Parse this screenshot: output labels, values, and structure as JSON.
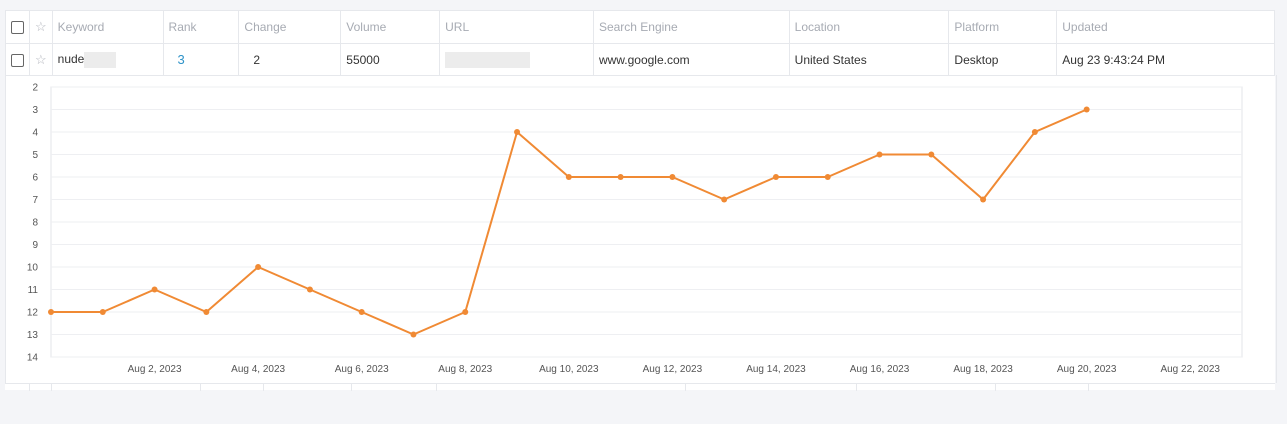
{
  "table": {
    "headers": {
      "keyword": "Keyword",
      "rank": "Rank",
      "change": "Change",
      "volume": "Volume",
      "url": "URL",
      "search_engine": "Search Engine",
      "location": "Location",
      "platform": "Platform",
      "updated": "Updated"
    },
    "row": {
      "keyword": "nude",
      "rank": "3",
      "change": "2",
      "volume": "55000",
      "url": "",
      "search_engine": "www.google.com",
      "location": "United States",
      "platform": "Desktop",
      "updated": "Aug 23 9:43:24 PM"
    }
  },
  "chart_data": {
    "type": "line",
    "title": "",
    "xlabel": "",
    "ylabel": "",
    "y_reversed": true,
    "ylim": [
      2,
      14
    ],
    "y_ticks": [
      "2",
      "3",
      "4",
      "5",
      "6",
      "7",
      "8",
      "9",
      "10",
      "11",
      "12",
      "13",
      "14"
    ],
    "x_range": [
      "2023-07-31",
      "2023-08-23"
    ],
    "x_tick_labels": [
      "Aug 2, 2023",
      "Aug 4, 2023",
      "Aug 6, 2023",
      "Aug 8, 2023",
      "Aug 10, 2023",
      "Aug 12, 2023",
      "Aug 14, 2023",
      "Aug 16, 2023",
      "Aug 18, 2023",
      "Aug 20, 2023",
      "Aug 22, 2023"
    ],
    "x_tick_dates": [
      "2023-08-02",
      "2023-08-04",
      "2023-08-06",
      "2023-08-08",
      "2023-08-10",
      "2023-08-12",
      "2023-08-14",
      "2023-08-16",
      "2023-08-18",
      "2023-08-20",
      "2023-08-22"
    ],
    "color": "#f08a34",
    "grid": true,
    "series": [
      {
        "x": [
          "2023-07-31",
          "2023-08-01",
          "2023-08-02",
          "2023-08-03",
          "2023-08-04",
          "2023-08-05",
          "2023-08-06",
          "2023-08-07",
          "2023-08-08",
          "2023-08-09",
          "2023-08-10",
          "2023-08-11",
          "2023-08-12",
          "2023-08-13",
          "2023-08-14",
          "2023-08-15",
          "2023-08-16",
          "2023-08-17",
          "2023-08-18",
          "2023-08-19",
          "2023-08-20",
          "2023-08-21"
        ],
        "values": [
          12,
          12,
          11,
          12,
          10,
          11,
          12,
          13,
          12,
          4,
          6,
          6,
          6,
          7,
          6,
          6,
          5,
          5,
          7,
          4,
          3,
          null
        ]
      }
    ]
  }
}
